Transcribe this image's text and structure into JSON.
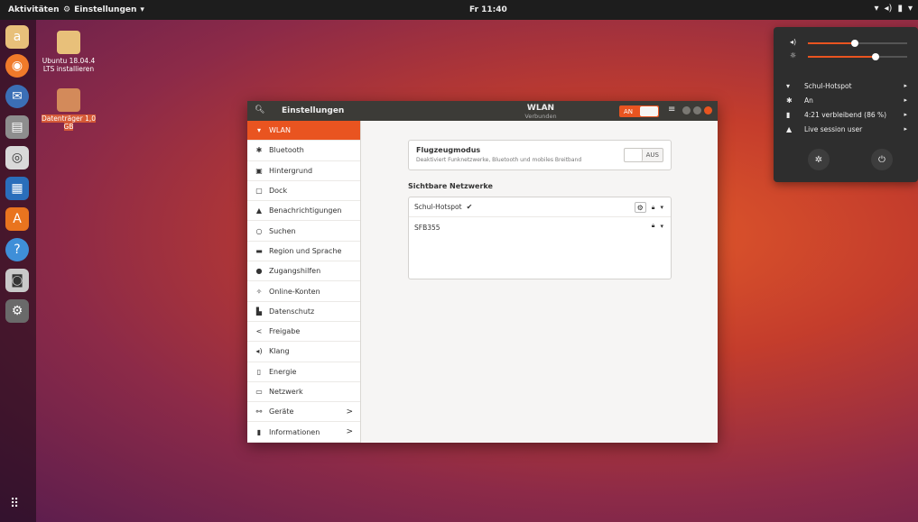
{
  "topbar": {
    "activities": "Aktivitäten",
    "app_menu": "Einstellungen",
    "clock": "Fr 11:40",
    "tray_icons": [
      "wifi-icon",
      "volume-icon",
      "battery-icon",
      "chevron-down-icon"
    ]
  },
  "dock": {
    "apps": [
      "Amazon",
      "Firefox",
      "Thunderbird",
      "Files",
      "Rhythmbox",
      "LibreOffice Writer",
      "Ubuntu Software",
      "Help",
      "Screenshot",
      "Settings"
    ]
  },
  "desktop": {
    "icons": [
      {
        "label": "Ubuntu 18.04.4 LTS installieren"
      },
      {
        "label": "Datenträger 1,0 GB"
      }
    ]
  },
  "window": {
    "search_icon": "search-icon",
    "left_title": "Einstellungen",
    "center_title": "WLAN",
    "center_subtitle": "Verbunden",
    "wifi_toggle": "AN",
    "sidebar": [
      {
        "label": "WLAN",
        "icon": "wifi-icon",
        "active": true
      },
      {
        "label": "Bluetooth",
        "icon": "bluetooth-icon"
      },
      {
        "label": "Hintergrund",
        "icon": "background-icon"
      },
      {
        "label": "Dock",
        "icon": "dock-icon"
      },
      {
        "label": "Benachrichtigungen",
        "icon": "bell-icon"
      },
      {
        "label": "Suchen",
        "icon": "search-icon"
      },
      {
        "label": "Region und Sprache",
        "icon": "flag-icon"
      },
      {
        "label": "Zugangshilfen",
        "icon": "accessibility-icon"
      },
      {
        "label": "Online-Konten",
        "icon": "online-accounts-icon"
      },
      {
        "label": "Datenschutz",
        "icon": "privacy-icon"
      },
      {
        "label": "Freigabe",
        "icon": "share-icon"
      },
      {
        "label": "Klang",
        "icon": "sound-icon"
      },
      {
        "label": "Energie",
        "icon": "power-icon"
      },
      {
        "label": "Netzwerk",
        "icon": "network-icon"
      },
      {
        "label": "Geräte",
        "icon": "devices-icon",
        "chevron": ">"
      },
      {
        "label": "Informationen",
        "icon": "info-icon",
        "chevron": ">"
      }
    ],
    "airplane": {
      "title": "Flugzeugmodus",
      "description": "Deaktiviert Funknetzwerke, Bluetooth und mobiles Breitband",
      "switch_label": "AUS"
    },
    "networks_title": "Sichtbare Netzwerke",
    "networks": [
      {
        "name": "Schul-Hotspot",
        "connected_mark": "✔"
      },
      {
        "name": "SFB355"
      }
    ]
  },
  "sysmenu": {
    "volume_level": 0.47,
    "brightness_level": 0.68,
    "items": [
      {
        "label": "Schul-Hotspot",
        "icon": "wifi-icon"
      },
      {
        "label": "An",
        "icon": "bluetooth-icon"
      },
      {
        "label": "4:21 verbleibend (86 %)",
        "icon": "battery-icon"
      },
      {
        "label": "Live session user",
        "icon": "user-icon"
      }
    ]
  },
  "colors": {
    "accent": "#e95420",
    "titlebar": "#3c3b37",
    "topbar": "#1d1d1d",
    "menu_bg": "#2e2e2e"
  }
}
